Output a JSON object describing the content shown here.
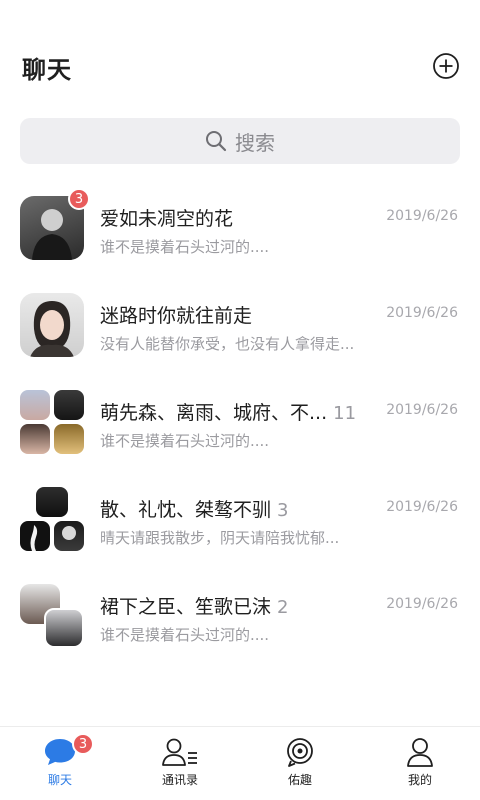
{
  "header": {
    "title": "聊天"
  },
  "search": {
    "placeholder": "搜索"
  },
  "conversations": [
    {
      "name": "爱如未凋空的花",
      "count": "",
      "time": "2019/6/26",
      "preview": "谁不是摸着石头过河的....",
      "badge": "3"
    },
    {
      "name": "迷路时你就往前走",
      "count": "",
      "time": "2019/6/26",
      "preview": "没有人能替你承受，也没有人拿得走...",
      "badge": ""
    },
    {
      "name": "萌先森、离雨、城府、不...",
      "count": "11",
      "time": "2019/6/26",
      "preview": "谁不是摸着石头过河的....",
      "badge": ""
    },
    {
      "name": "散、礼忱、桀骜不驯",
      "count": "3",
      "time": "2019/6/26",
      "preview": "晴天请跟我散步，阴天请陪我忧郁...",
      "badge": ""
    },
    {
      "name": "裙下之臣、笙歌已沫",
      "count": "2",
      "time": "2019/6/26",
      "preview": "谁不是摸着石头过河的....",
      "badge": ""
    }
  ],
  "tabs": [
    {
      "label": "聊天",
      "icon": "chat-bubble-icon",
      "active": true,
      "badge": "3"
    },
    {
      "label": "通讯录",
      "icon": "contacts-icon",
      "active": false,
      "badge": ""
    },
    {
      "label": "佑趣",
      "icon": "discover-icon",
      "active": false,
      "badge": ""
    },
    {
      "label": "我的",
      "icon": "profile-icon",
      "active": false,
      "badge": ""
    }
  ],
  "colors": {
    "accent": "#2c7be5",
    "badge": "#e85b5b",
    "search_bg": "#eeeef1"
  }
}
